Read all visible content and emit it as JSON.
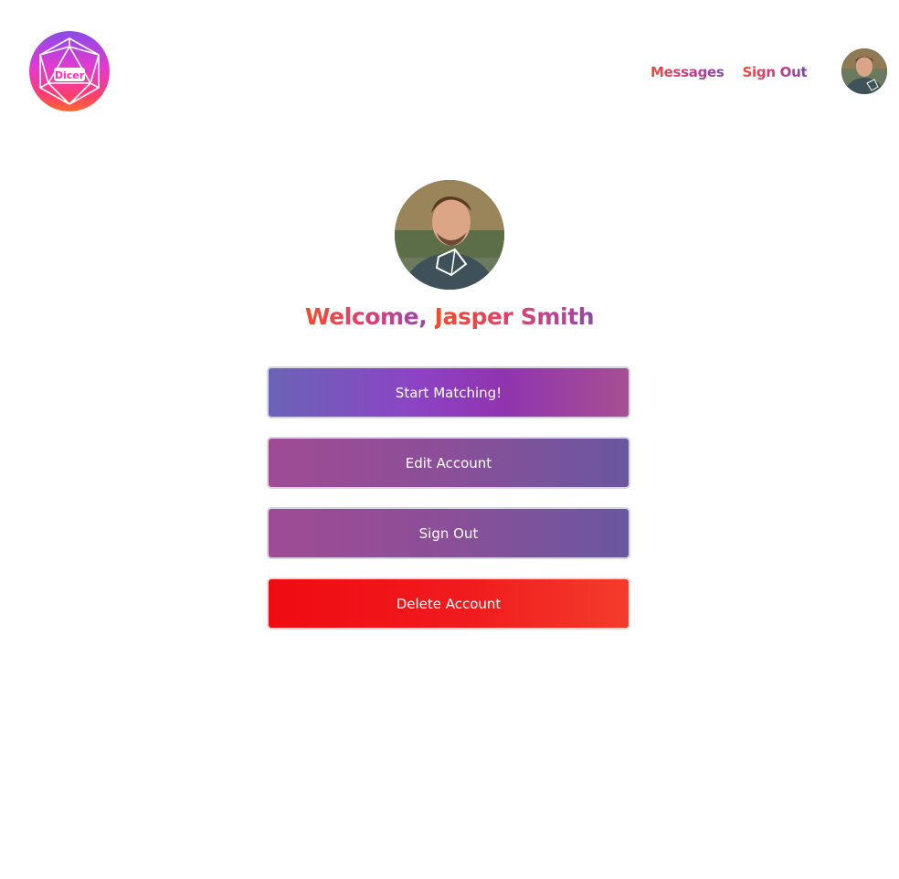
{
  "brand": {
    "logo_text": "Dicer"
  },
  "nav": {
    "messages_label": "Messages",
    "signout_label": "Sign Out"
  },
  "profile": {
    "welcome_prefix": "Welcome,",
    "name": "Jasper Smith"
  },
  "actions": {
    "start_matching": "Start Matching!",
    "edit_account": "Edit Account",
    "sign_out": "Sign Out",
    "delete_account": "Delete Account"
  },
  "colors": {
    "accent_start": "#f04a3a",
    "accent_end": "#7a4bb0",
    "danger": "#ef0b12"
  }
}
